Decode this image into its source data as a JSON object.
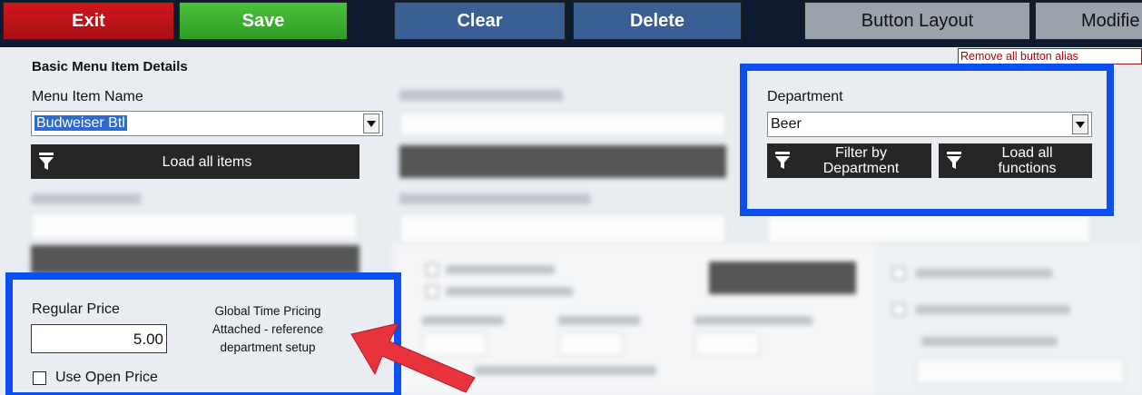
{
  "toolbar": {
    "exit_label": "Exit",
    "save_label": "Save",
    "clear_label": "Clear",
    "delete_label": "Delete",
    "button_layout_label": "Button Layout",
    "modifier_label": "Modifie"
  },
  "remove_alias_label": "Remove all button alias",
  "section_title": "Basic Menu Item Details",
  "menu_item": {
    "label": "Menu Item Name",
    "value": "Budweiser Btl",
    "load_all_label": "Load all items"
  },
  "department": {
    "label": "Department",
    "value": "Beer",
    "filter_label_line1": "Filter by",
    "filter_label_line2": "Department",
    "load_functions_line1": "Load all",
    "load_functions_line2": "functions"
  },
  "price": {
    "label": "Regular Price",
    "value": "5.00",
    "note": "Global Time Pricing Attached - reference department setup",
    "open_price_label": "Use Open Price"
  },
  "colors": {
    "highlight": "#0b4ff0",
    "arrow": "#e8323c",
    "exit": "#c8141a",
    "save": "#3fb32f",
    "action": "#3a5f95"
  }
}
